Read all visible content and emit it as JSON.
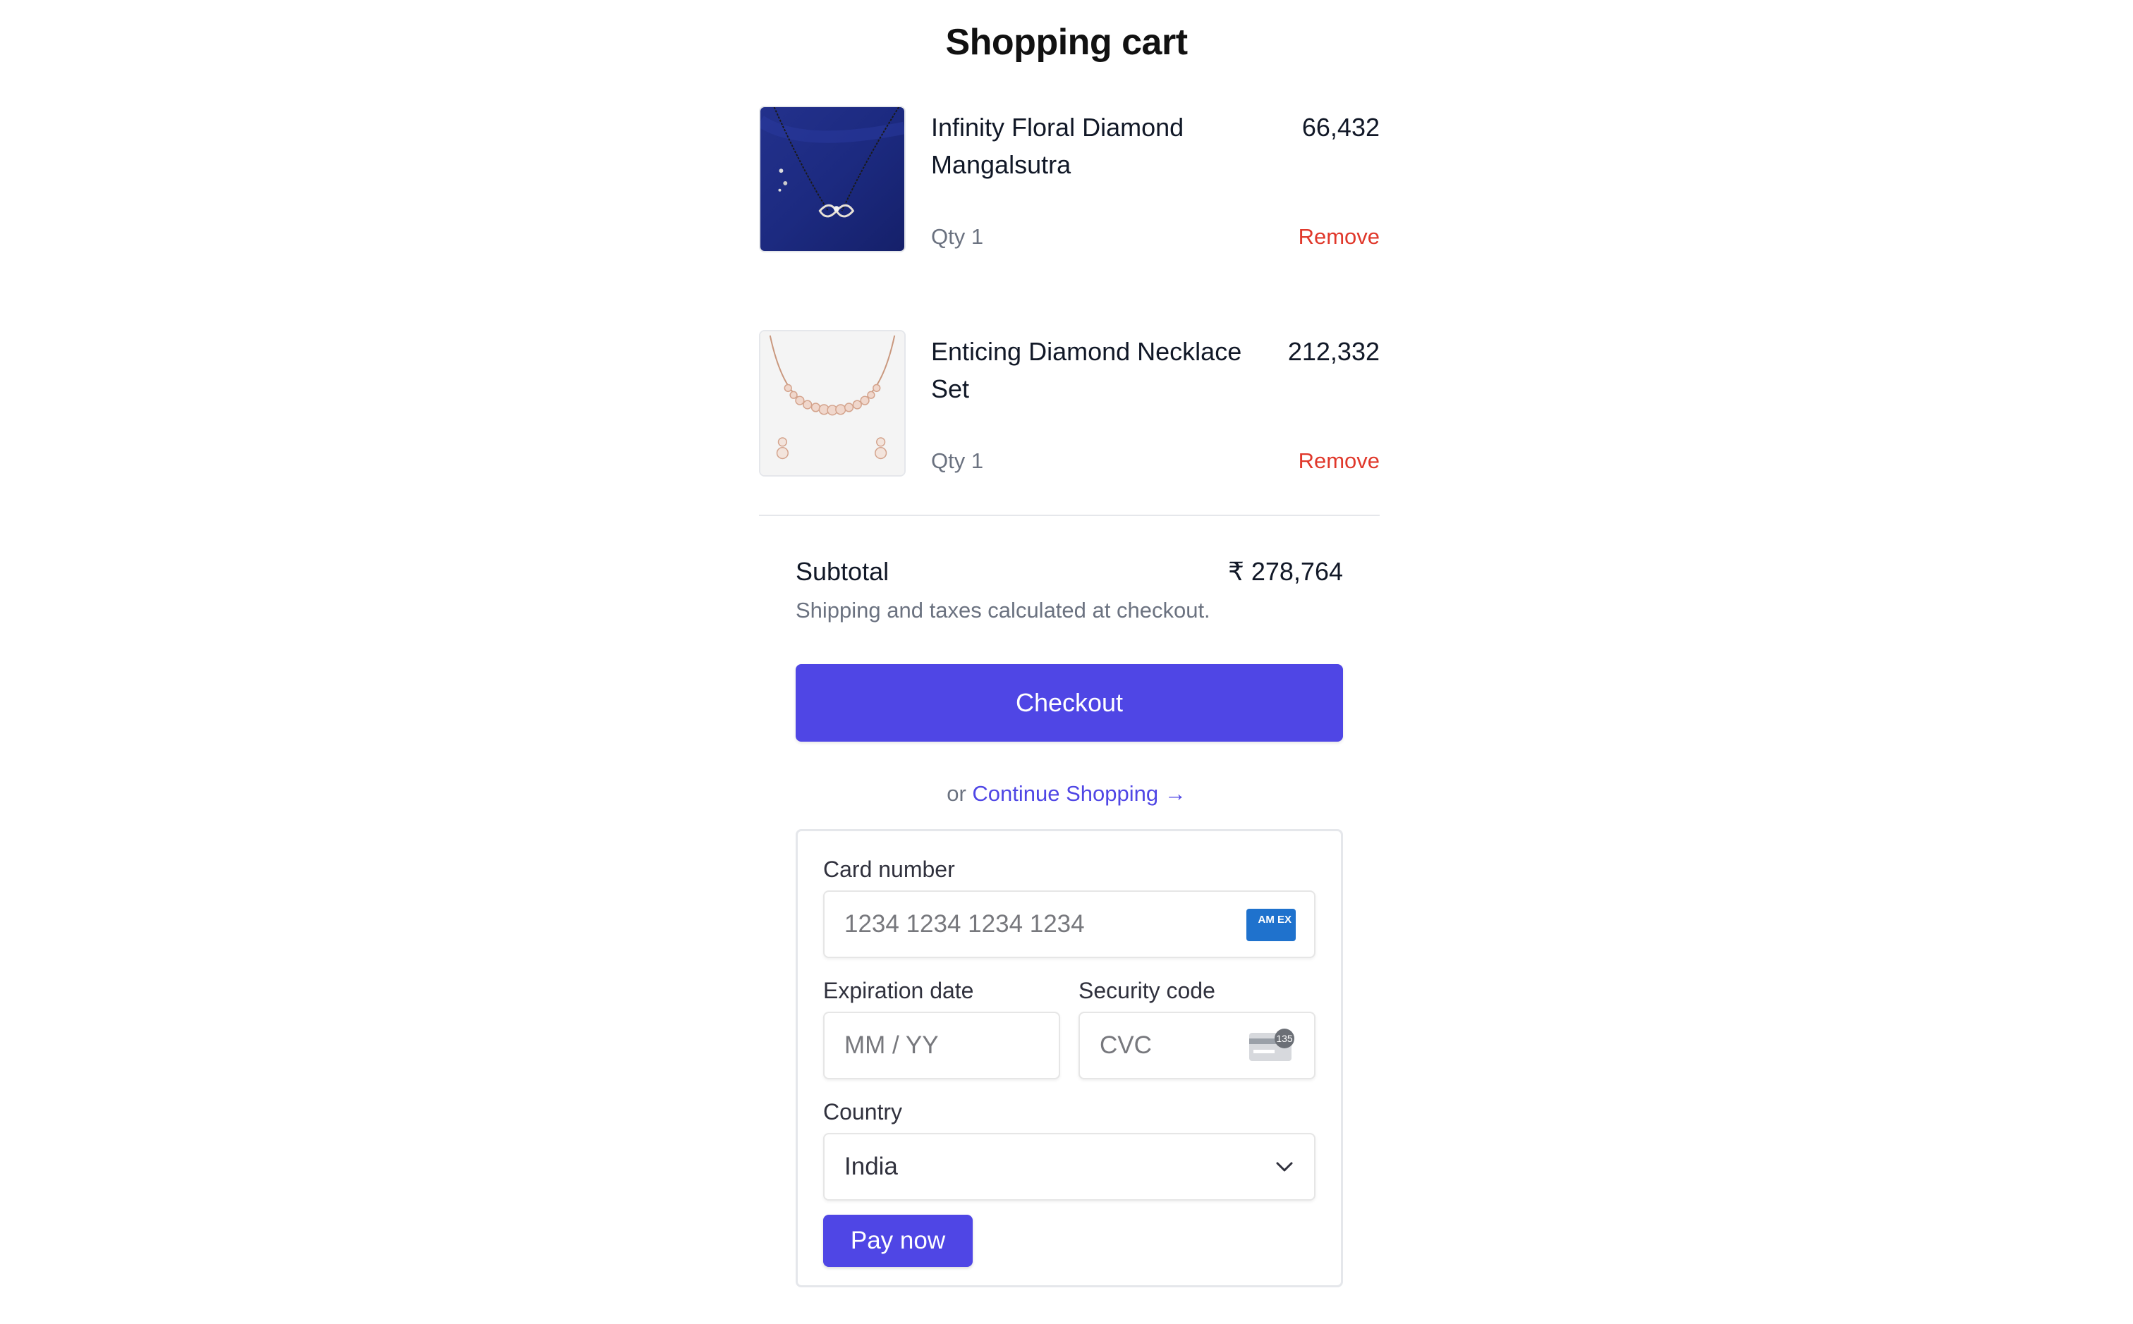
{
  "page": {
    "title": "Shopping cart"
  },
  "cart": {
    "items": [
      {
        "name": "Infinity Floral Diamond Mangalsutra",
        "price": "66,432",
        "qty": "Qty 1",
        "remove_label": "Remove"
      },
      {
        "name": "Enticing Diamond Necklace Set",
        "price": "212,332",
        "qty": "Qty 1",
        "remove_label": "Remove"
      }
    ]
  },
  "summary": {
    "subtotal_label": "Subtotal",
    "subtotal_value": "₹ 278,764",
    "note": "Shipping and taxes calculated at checkout.",
    "checkout_label": "Checkout",
    "or_text": "or",
    "continue_label": "Continue Shopping",
    "continue_arrow": "→"
  },
  "payment": {
    "card_number_label": "Card number",
    "card_number_placeholder": "1234 1234 1234 1234",
    "card_brand_icon": "amex-icon",
    "card_brand_text": "AM EX",
    "expiry_label": "Expiration date",
    "expiry_placeholder": "MM / YY",
    "cvc_label": "Security code",
    "cvc_placeholder": "CVC",
    "cvc_icon_text": "135",
    "country_label": "Country",
    "country_value": "India",
    "pay_label": "Pay now"
  },
  "colors": {
    "accent": "#4f46e5",
    "remove": "#e0382b",
    "muted": "#6b7280",
    "amex": "#1f72cd"
  }
}
